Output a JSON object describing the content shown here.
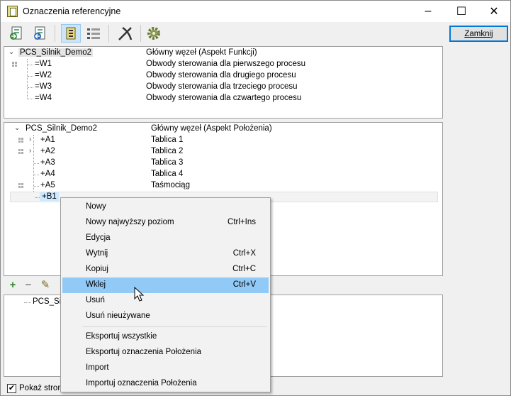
{
  "window": {
    "title": "Oznaczenia referencyjne",
    "minimize": "–",
    "maximize": "☐",
    "close": "✕"
  },
  "toolbar": {
    "close_button": "Zamknij",
    "buttons": [
      "import-icon",
      "export-icon",
      "tree-view-icon",
      "list-view-icon",
      "cut-icon",
      "settings-icon"
    ]
  },
  "function_tree": {
    "root": {
      "name": "PCS_Silnik_Demo2",
      "description": "Główny węzeł  (Aspekt Funkcji)"
    },
    "items": [
      {
        "name": "=W1",
        "description": "Obwody sterowania dla pierwszego procesu"
      },
      {
        "name": "=W2",
        "description": "Obwody sterowania dla drugiego procesu"
      },
      {
        "name": "=W3",
        "description": "Obwody sterowania dla trzeciego procesu"
      },
      {
        "name": "=W4",
        "description": "Obwody sterowania dla czwartego procesu"
      }
    ]
  },
  "location_tree": {
    "root": {
      "name": "PCS_Silnik_Demo2",
      "description": "Główny węzeł  (Aspekt Położenia)"
    },
    "items": [
      {
        "name": "+A1",
        "description": "Tablica 1"
      },
      {
        "name": "+A2",
        "description": "Tablica 2"
      },
      {
        "name": "+A3",
        "description": "Tablica 3"
      },
      {
        "name": "+A4",
        "description": "Tablica 4"
      },
      {
        "name": "+A5",
        "description": "Taśmociąg"
      },
      {
        "name": "+B1",
        "description": ""
      }
    ]
  },
  "bottom_pane": {
    "root_partial": "PCS_Silni"
  },
  "pane_tools": {
    "add": "+",
    "remove": "−",
    "edit": "✎"
  },
  "footer": {
    "checkbox_label": "Pokaż stron",
    "checkbox_checked": true
  },
  "context_menu": {
    "items": [
      {
        "label": "Nowy",
        "shortcut": ""
      },
      {
        "label": "Nowy najwyższy poziom",
        "shortcut": "Ctrl+Ins"
      },
      {
        "label": "Edycja",
        "shortcut": ""
      },
      {
        "label": "Wytnij",
        "shortcut": "Ctrl+X"
      },
      {
        "label": "Kopiuj",
        "shortcut": "Ctrl+C"
      },
      {
        "label": "Wklej",
        "shortcut": "Ctrl+V"
      },
      {
        "label": "Usuń",
        "shortcut": ""
      },
      {
        "label": "Usuń nieużywane",
        "shortcut": ""
      },
      {
        "label": "Eksportuj wszystkie",
        "shortcut": ""
      },
      {
        "label": "Eksportuj oznaczenia Położenia",
        "shortcut": ""
      },
      {
        "label": "Import",
        "shortcut": ""
      },
      {
        "label": "Importuj oznaczenia Położenia",
        "shortcut": ""
      }
    ],
    "highlighted": "Wklej"
  }
}
